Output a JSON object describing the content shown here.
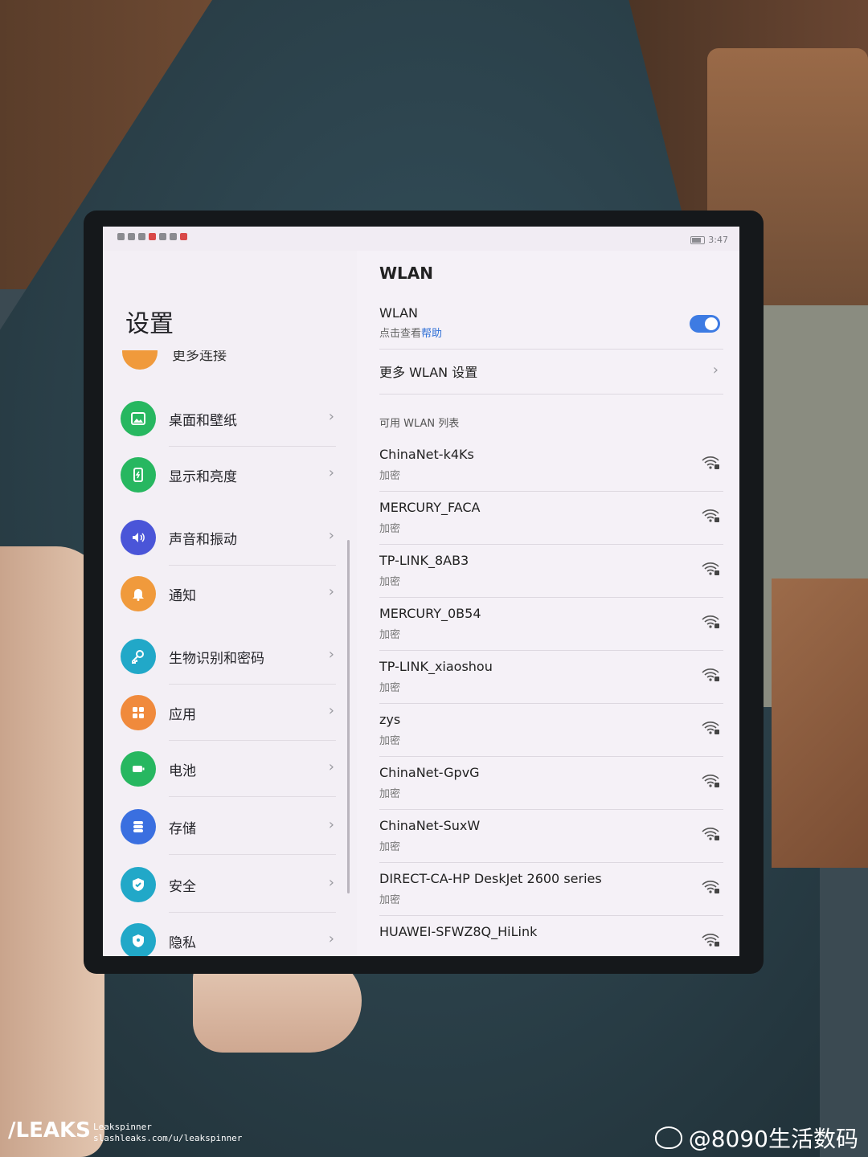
{
  "status_bar": {
    "time": "3:47"
  },
  "left_panel": {
    "title": "设置",
    "partial_item_label": "更多连接",
    "items": [
      {
        "label": "桌面和壁纸",
        "icon": "wallpaper-icon",
        "color": "#27b760"
      },
      {
        "label": "显示和亮度",
        "icon": "display-icon",
        "color": "#27b760"
      },
      {
        "label": "声音和振动",
        "icon": "sound-icon",
        "color": "#4a55d8"
      },
      {
        "label": "通知",
        "icon": "bell-icon",
        "color": "#f09a3c"
      },
      {
        "label": "生物识别和密码",
        "icon": "key-icon",
        "color": "#21a8c8"
      },
      {
        "label": "应用",
        "icon": "apps-icon",
        "color": "#f08a3c"
      },
      {
        "label": "电池",
        "icon": "battery-icon",
        "color": "#27b760"
      },
      {
        "label": "存储",
        "icon": "storage-icon",
        "color": "#3a6fe0"
      },
      {
        "label": "安全",
        "icon": "shield-icon",
        "color": "#21a8c8"
      },
      {
        "label": "隐私",
        "icon": "privacy-icon",
        "color": "#21a8c8"
      }
    ]
  },
  "right_panel": {
    "title": "WLAN",
    "wlan_label": "WLAN",
    "help_prefix": "点击查看",
    "help_link": "帮助",
    "wlan_enabled": true,
    "more_settings": "更多 WLAN 设置",
    "list_header": "可用 WLAN 列表",
    "networks": [
      {
        "ssid": "ChinaNet-k4Ks",
        "security": "加密"
      },
      {
        "ssid": "MERCURY_FACA",
        "security": "加密"
      },
      {
        "ssid": "TP-LINK_8AB3",
        "security": "加密"
      },
      {
        "ssid": "MERCURY_0B54",
        "security": "加密"
      },
      {
        "ssid": "TP-LINK_xiaoshou",
        "security": "加密"
      },
      {
        "ssid": "zys",
        "security": "加密"
      },
      {
        "ssid": "ChinaNet-GpvG",
        "security": "加密"
      },
      {
        "ssid": "ChinaNet-SuxW",
        "security": "加密"
      },
      {
        "ssid": "DIRECT-CA-HP DeskJet 2600 series",
        "security": "加密"
      },
      {
        "ssid": "HUAWEI-SFWZ8Q_HiLink",
        "security": ""
      }
    ]
  },
  "watermarks": {
    "leaks": "/LEAKS",
    "leaks_line1": "Leakspinner",
    "leaks_line2": "slashleaks.com/u/leakspinner",
    "weibo": "@8090生活数码"
  }
}
